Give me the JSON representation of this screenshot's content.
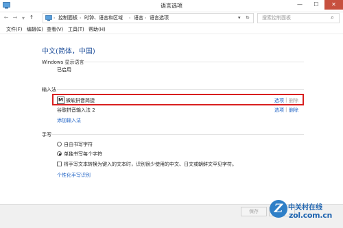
{
  "window": {
    "title": "语言选项",
    "controls": {
      "minimize": "—",
      "maximize": "☐",
      "close": "✕"
    }
  },
  "address_bar": {
    "back": "←",
    "forward": "→",
    "up": "↑",
    "breadcrumbs": [
      "控制面板",
      "时钟、语言和区域",
      "语言",
      "语言选项"
    ],
    "separator": "›",
    "dropdown": "▾",
    "refresh": "↻",
    "search_placeholder": "搜索控制面板",
    "search_icon": "⌕"
  },
  "menu": [
    "文件(F)",
    "编辑(E)",
    "查看(V)",
    "工具(T)",
    "帮助(H)"
  ],
  "main": {
    "heading": "中文(简体，中国)",
    "display_language": {
      "label": "Windows 显示语言",
      "status": "已启用"
    },
    "input_methods": {
      "label": "输入法",
      "items": [
        {
          "name": "微软拼音简捷",
          "options": "选项",
          "divider": "|",
          "remove": "删除"
        },
        {
          "name": "谷歌拼音输入法 2",
          "options": "选项",
          "divider": "|",
          "remove": "删除"
        }
      ],
      "add_link": "添加输入法",
      "ime_icon": "M"
    },
    "handwriting": {
      "label": "手写",
      "radio_freeform": "自由书写字符",
      "radio_single": "单独书写每个字符",
      "checkbox_text": "将手写文本转换为键入的文本时，识别很少使用的中文、日文或朝鲜文罕见字符。",
      "personalize_link": "个性化手写识别"
    }
  },
  "footer": {
    "save": "保存",
    "cancel": "取消"
  },
  "watermark": {
    "mark": "Z",
    "brand": "中关村在线",
    "url": "zol.com.cn"
  },
  "colors": {
    "heading": "#1e4e9a",
    "link": "#1e62c5",
    "highlight": "#d81e1e",
    "close_button": "#c7503f",
    "watermark": "#1e64b0"
  }
}
